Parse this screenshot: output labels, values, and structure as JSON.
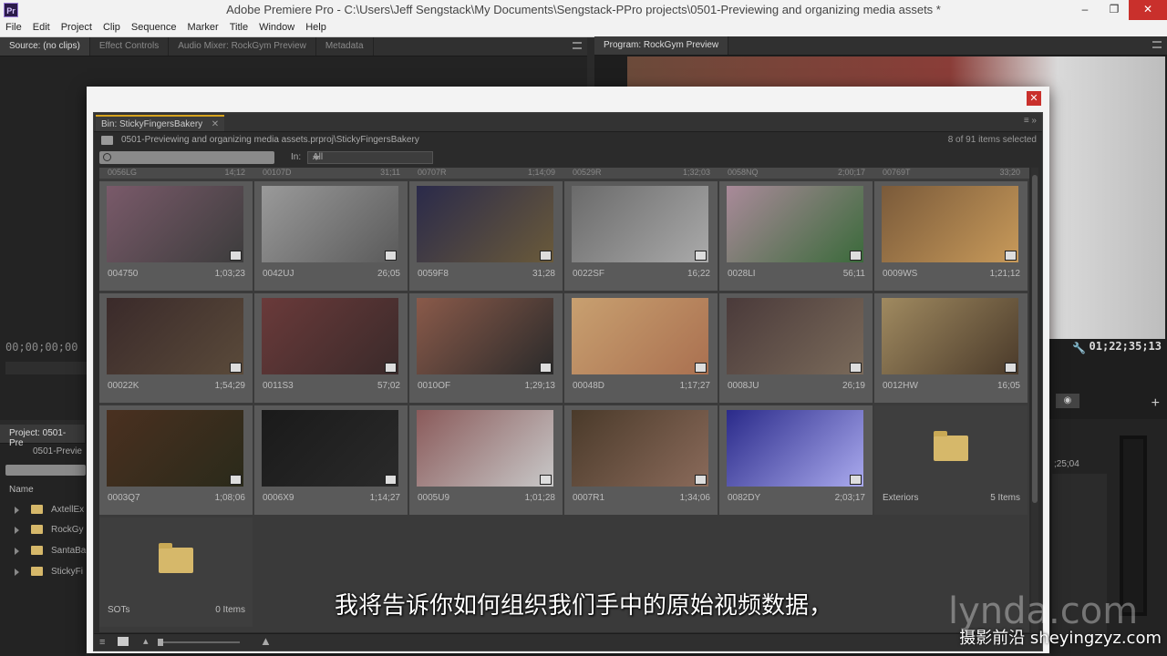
{
  "window": {
    "title": "Adobe Premiere Pro - C:\\Users\\Jeff Sengstack\\My Documents\\Sengstack-PPro projects\\0501-Previewing and organizing media assets *",
    "app_icon_label": "Pr"
  },
  "menu": [
    "File",
    "Edit",
    "Project",
    "Clip",
    "Sequence",
    "Marker",
    "Title",
    "Window",
    "Help"
  ],
  "source_panel": {
    "tabs": [
      "Source: (no clips)",
      "Effect Controls",
      "Audio Mixer: RockGym Preview",
      "Metadata"
    ],
    "timecode": "00;00;00;00"
  },
  "program_panel": {
    "tab": "Program: RockGym Preview",
    "timecode": "01;22;35;13"
  },
  "project_panel": {
    "tab": "Project: 0501-Pre",
    "file": "0501-Previe",
    "column_name": "Name",
    "items": [
      "AxtellEx",
      "RockGy",
      "SantaBa",
      "StickyFi"
    ]
  },
  "timeline_right": {
    "timecode": ";25;04"
  },
  "bin": {
    "tab": "Bin: StickyFingersBakery",
    "path": "0501-Previewing and organizing media assets.prproj\\StickyFingersBakery",
    "selected_count": "8 of 91 items selected",
    "in_label": "In:",
    "in_value": "All",
    "partial_row": [
      {
        "name": "0056LG",
        "dur": "14;12"
      },
      {
        "name": "00107D",
        "dur": "31;11"
      },
      {
        "name": "00707R",
        "dur": "1;14;09"
      },
      {
        "name": "00529R",
        "dur": "1;32;03"
      },
      {
        "name": "0058NQ",
        "dur": "2;00;17"
      },
      {
        "name": "00769T",
        "dur": "33;20"
      }
    ],
    "clips": [
      {
        "name": "004750",
        "dur": "1;03;23"
      },
      {
        "name": "0042UJ",
        "dur": "26;05"
      },
      {
        "name": "0059F8",
        "dur": "31;28"
      },
      {
        "name": "0022SF",
        "dur": "16;22"
      },
      {
        "name": "0028LI",
        "dur": "56;11"
      },
      {
        "name": "0009WS",
        "dur": "1;21;12"
      },
      {
        "name": "00022K",
        "dur": "1;54;29"
      },
      {
        "name": "0011S3",
        "dur": "57;02"
      },
      {
        "name": "0010OF",
        "dur": "1;29;13"
      },
      {
        "name": "00048D",
        "dur": "1;17;27"
      },
      {
        "name": "0008JU",
        "dur": "26;19"
      },
      {
        "name": "0012HW",
        "dur": "16;05"
      },
      {
        "name": "0003Q7",
        "dur": "1;08;06"
      },
      {
        "name": "0006X9",
        "dur": "1;14;27"
      },
      {
        "name": "0005U9",
        "dur": "1;01;28"
      },
      {
        "name": "0007R1",
        "dur": "1;34;06"
      },
      {
        "name": "0082DY",
        "dur": "2;03;17"
      }
    ],
    "folders": [
      {
        "name": "Exteriors",
        "count": "5 Items"
      },
      {
        "name": "SOTs",
        "count": "0 Items"
      }
    ]
  },
  "overlay": {
    "subtitle": "我将告诉你如何组织我们手中的原始视频数据，",
    "watermark": "摄影前沿 sheyingzyz.com",
    "lynda": "lynda.com"
  },
  "colors": {
    "accent_tab": "#d6a21d",
    "close_red": "#c9302c",
    "folder": "#d6b86a"
  }
}
